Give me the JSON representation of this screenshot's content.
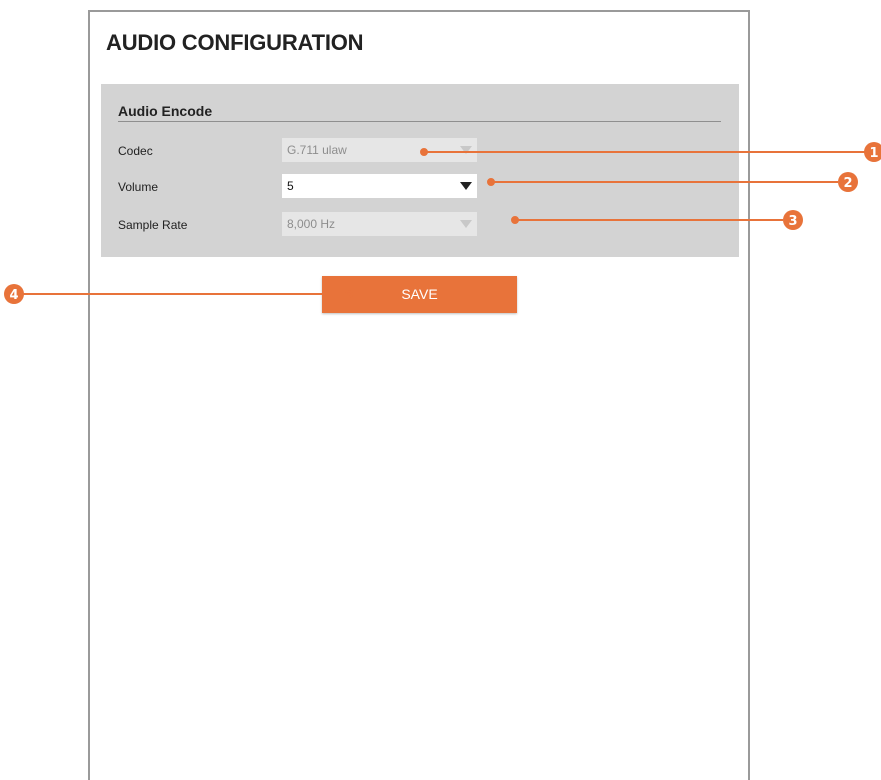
{
  "title": "AUDIO CONFIGURATION",
  "section": {
    "title": "Audio Encode",
    "fields": [
      {
        "label": "Codec",
        "value": "G.711 ulaw",
        "enabled": false
      },
      {
        "label": "Volume",
        "value": "5",
        "enabled": true
      },
      {
        "label": "Sample Rate",
        "value": "8,000 Hz",
        "enabled": false
      }
    ]
  },
  "save_label": "SAVE",
  "callouts": [
    "1",
    "2",
    "3",
    "4"
  ],
  "colors": {
    "accent": "#e8733a",
    "panel_bg": "#d3d3d3",
    "disabled_field": "#e6e6e6"
  }
}
